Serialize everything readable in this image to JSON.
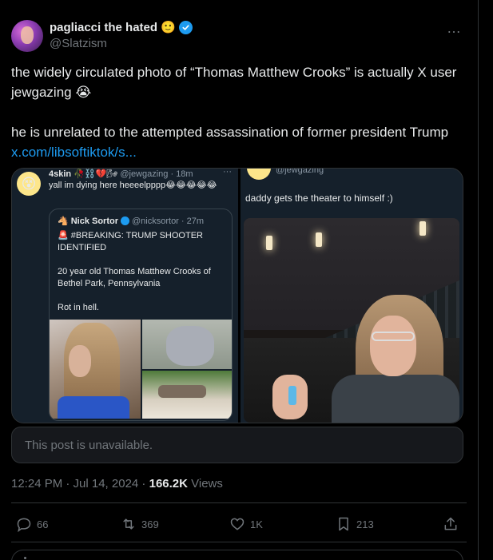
{
  "author": {
    "display_name": "pagliacci the hated",
    "name_emoji": "🙂",
    "handle": "@Slatzism"
  },
  "more_icon": "…",
  "post": {
    "line1": "the widely circulated photo of “Thomas Matthew Crooks” is actually X user jewgazing 😭",
    "line2_text": "he is unrelated to the attempted assassination of former president Trump ",
    "line2_link": "x.com/libsoftiktok/s..."
  },
  "left_shot": {
    "avatar_emoji": "😵",
    "name": "4skin",
    "badges": "🥀⛓️💔🌬",
    "handle_time": "@jewgazing · 18m",
    "dots": "···",
    "text": "yall im dying here heeeelpppp😂😂😂😂😂",
    "quote": {
      "name_emoji": "🐴",
      "name": "Nick Sortor",
      "handle_time": "@nicksortor · 27m",
      "headline": "🚨 #BREAKING: TRUMP SHOOTER IDENTIFIED",
      "body": "20 year old Thomas Matthew Crooks of Bethel Park, Pennsylvania",
      "closing": "Rot in hell."
    }
  },
  "right_shot": {
    "handle": "@jewgazing",
    "text": "daddy gets the theater to himself :)"
  },
  "unavailable": "This post is unavailable.",
  "meta": {
    "time": "12:24 PM · Jul 14, 2024 · ",
    "views_count": "166.2K",
    "views_label": " Views"
  },
  "actions": {
    "replies": "66",
    "reposts": "369",
    "likes": "1K",
    "bookmarks": "213"
  },
  "colors": {
    "background": "#000000",
    "accent": "#1d9bf0",
    "muted": "#71767b",
    "text": "#e7e9ea"
  }
}
